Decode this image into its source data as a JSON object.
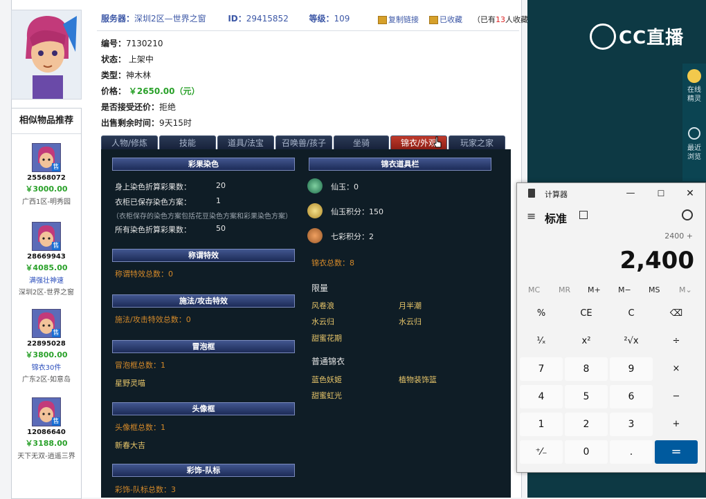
{
  "header": {
    "server_label": "服务器：",
    "server_value": "深圳2区—世界之窗",
    "id_label": "ID：",
    "id_value": "29415852",
    "level_label": "等级：",
    "level_value": "109",
    "copy_link": "复制链接",
    "collected": "已收藏",
    "collect_count_prefix": "（已有",
    "collect_count": "13",
    "collect_count_suffix": "人收藏）"
  },
  "info": {
    "number_label": "编号：",
    "number_value": "7130210",
    "status_label": "状态：",
    "status_value": "上架中",
    "type_label": "类型：",
    "type_value": "神木林",
    "price_label": "价格：",
    "price_value": "￥2650.00（元）",
    "bargain_label": "是否接受还价：",
    "bargain_value": "拒绝",
    "time_label": "出售剩余时间：",
    "time_value": "9天15时"
  },
  "recommend": {
    "title": "相似物品推荐",
    "tag": "售",
    "items": [
      {
        "id": "25568072",
        "price": "￥3000.00",
        "extra": "",
        "server": "广西1区-明秀园"
      },
      {
        "id": "28669943",
        "price": "￥4085.00",
        "extra": "满强壮神速",
        "server": "深圳2区-世界之窗"
      },
      {
        "id": "22895028",
        "price": "￥3800.00",
        "extra": "锦衣30件",
        "server": "广东2区-如意岛"
      },
      {
        "id": "12086640",
        "price": "￥3188.00",
        "extra": "",
        "server": "天下无双-逍遥三界"
      }
    ]
  },
  "tabs": [
    "人物/修炼",
    "技能",
    "道具/法宝",
    "召唤兽/孩子",
    "坐骑",
    "锦衣/外观",
    "玩家之家"
  ],
  "left_col": {
    "sec1": "彩果染色",
    "s1_l1": "身上染色折算彩果数：",
    "s1_v1": "20",
    "s1_l2": "衣柜已保存染色方案：",
    "s1_v2": "1",
    "s1_note": "（衣柜保存的染色方案包括花豆染色方案和彩果染色方案）",
    "s1_l3": "所有染色折算彩果数：",
    "s1_v3": "50",
    "sec2": "称谓特效",
    "s2_l1": "称谓特效总数：0",
    "sec3": "施法/攻击特效",
    "s3_l1": "施法/攻击特效总数：0",
    "sec4": "冒泡框",
    "s4_l1": "冒泡框总数：1",
    "s4_i1": "星野灵喵",
    "sec5": "头像框",
    "s5_l1": "头像框总数：1",
    "s5_i1": "新春大吉",
    "sec6": "彩饰-队标",
    "s6_l1": "彩饰-队标总数：3"
  },
  "right_col": {
    "sec": "锦衣道具栏",
    "xianyu": "仙玉：0",
    "xianyu_points": "仙玉积分：150",
    "qicai_points": "七彩积分：2",
    "jinyi_total": "锦衣总数：8",
    "limited_title": "限量",
    "limited": [
      "风卷浪",
      "月半潮",
      "水云归",
      "水云归",
      "甜蜜花期"
    ],
    "normal_title": "普通锦衣",
    "normal": [
      "蓝色妖姬",
      "植物装饰篮",
      "甜蜜虹光"
    ]
  },
  "sidebar": {
    "logo": "CC直播",
    "btn1": "在线精灵",
    "btn2": "最近浏览",
    "btn3": "浏览"
  },
  "calculator": {
    "title": "计算器",
    "mode": "标准",
    "expression": "2400 +",
    "display": "2,400",
    "memory": [
      "MC",
      "MR",
      "M+",
      "M−",
      "MS",
      "M⌄"
    ],
    "keys": [
      [
        "%",
        "CE",
        "C",
        "⌫"
      ],
      [
        "¹⁄ₓ",
        "x²",
        "²√x",
        "÷"
      ],
      [
        "7",
        "8",
        "9",
        "×"
      ],
      [
        "4",
        "5",
        "6",
        "−"
      ],
      [
        "1",
        "2",
        "3",
        "+"
      ],
      [
        "⁺⁄₋",
        "0",
        ".",
        "="
      ]
    ],
    "accent": "#005a9e"
  }
}
